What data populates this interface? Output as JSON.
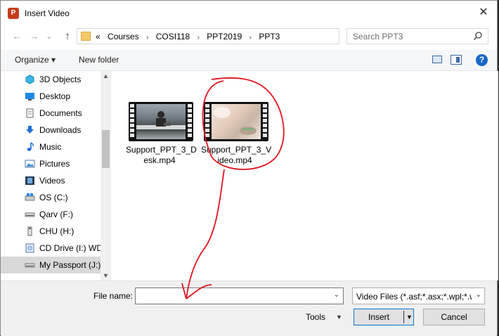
{
  "window": {
    "title": "Insert Video",
    "app_icon": "powerpoint-icon",
    "close": "✕"
  },
  "nav": {
    "back": "←",
    "forward": "→",
    "history": "⌄",
    "up": "↑"
  },
  "address": {
    "crumbs": [
      "«",
      "Courses",
      "COSI118",
      "PPT2019",
      "PPT3"
    ],
    "separator": "›"
  },
  "search": {
    "placeholder": "Search PPT3"
  },
  "toolbar": {
    "organize": "Organize ▾",
    "new_folder": "New folder",
    "help": "?"
  },
  "sidebar": {
    "items": [
      {
        "label": "3D Objects",
        "icon": "cube-icon"
      },
      {
        "label": "Desktop",
        "icon": "desktop-icon"
      },
      {
        "label": "Documents",
        "icon": "document-icon"
      },
      {
        "label": "Downloads",
        "icon": "download-icon"
      },
      {
        "label": "Music",
        "icon": "music-icon"
      },
      {
        "label": "Pictures",
        "icon": "picture-icon"
      },
      {
        "label": "Videos",
        "icon": "film-icon"
      },
      {
        "label": "OS (C:)",
        "icon": "windows-drive-icon"
      },
      {
        "label": "Qarv (F:)",
        "icon": "drive-icon"
      },
      {
        "label": "CHU (H:)",
        "icon": "usb-drive-icon"
      },
      {
        "label": "CD Drive (I:) WD",
        "icon": "cd-drive-icon"
      },
      {
        "label": "My Passport (J:)",
        "icon": "drive-icon"
      }
    ],
    "selected_index": 11
  },
  "files": [
    {
      "line1": "Support_PPT_3_D",
      "line2": "esk.mp4"
    },
    {
      "line1": "Support_PPT_3_V",
      "line2": "ideo.mp4"
    }
  ],
  "bottom": {
    "filename_label": "File name:",
    "filename_value": "",
    "filter": "Video Files (*.asf;*.asx;*.wpl;*.w",
    "tools": "Tools",
    "insert": "Insert",
    "cancel": "Cancel"
  },
  "colors": {
    "annotation": "#e0141e",
    "accent": "#0078d7"
  }
}
